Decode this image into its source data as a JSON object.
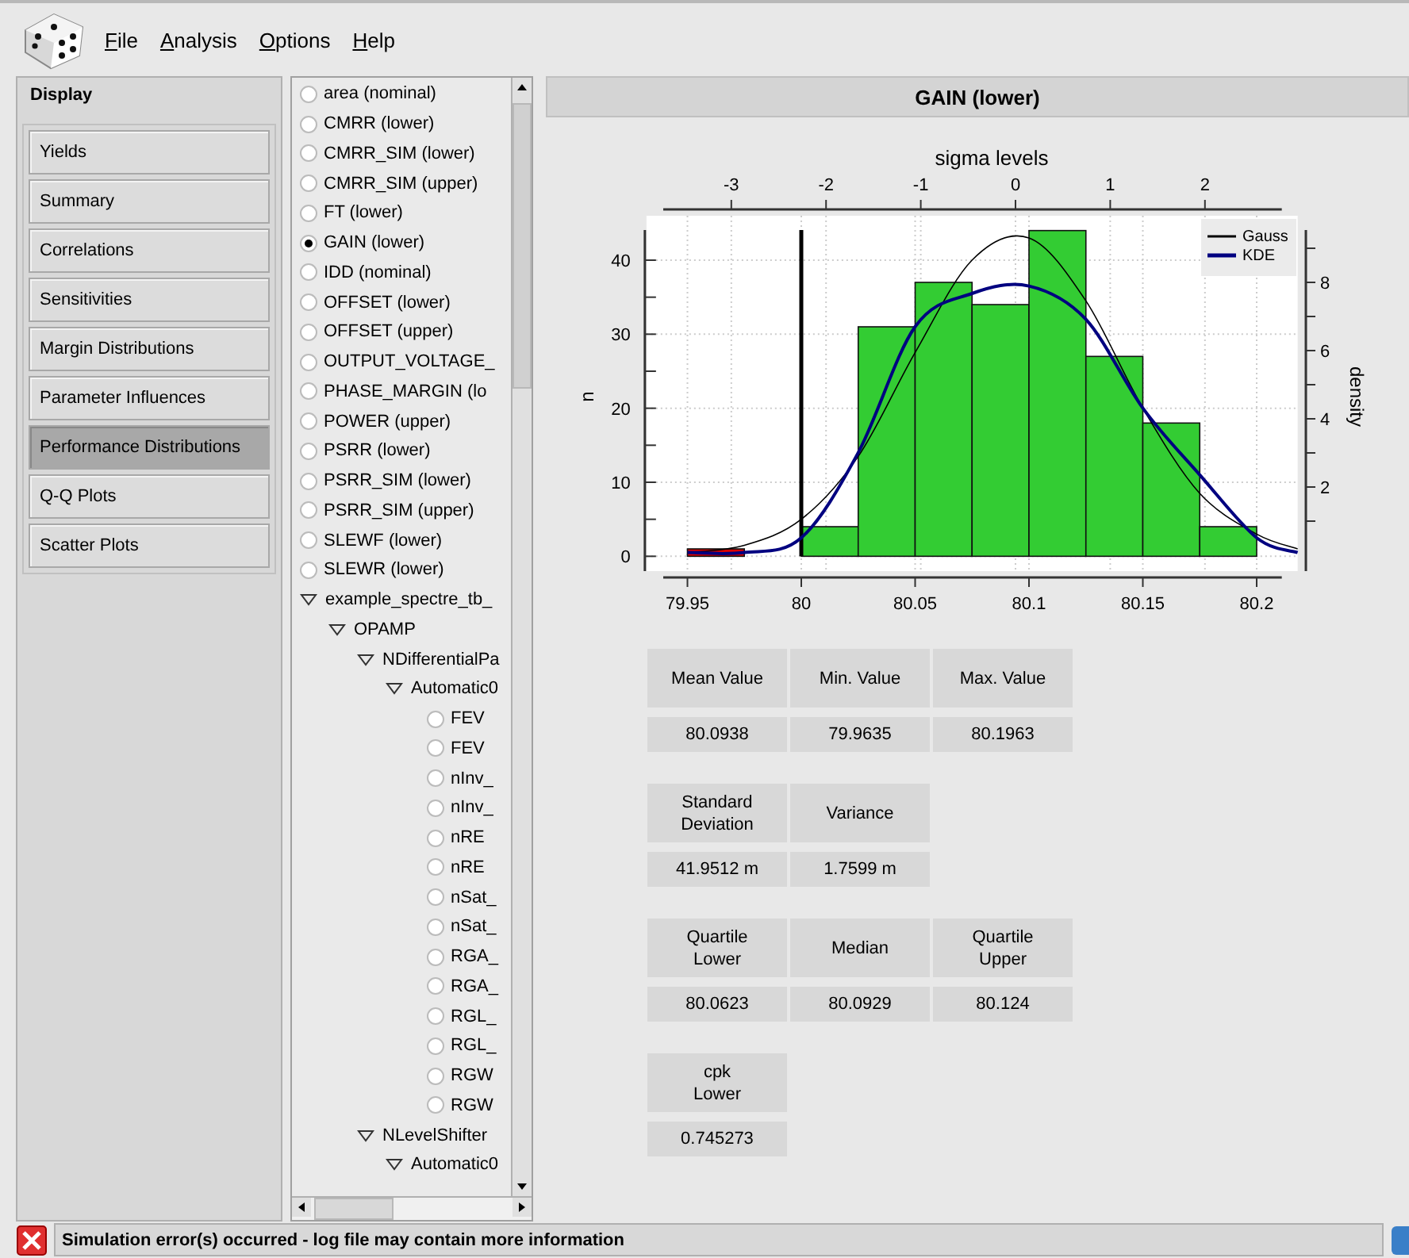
{
  "menu": [
    "File",
    "Analysis",
    "Options",
    "Help"
  ],
  "sidebar": {
    "title": "Display",
    "items": [
      {
        "label": "Yields",
        "selected": false
      },
      {
        "label": "Summary",
        "selected": false
      },
      {
        "label": "Correlations",
        "selected": false
      },
      {
        "label": "Sensitivities",
        "selected": false
      },
      {
        "label": "Margin Distributions",
        "selected": false
      },
      {
        "label": "Parameter Influences",
        "selected": false
      },
      {
        "label": "Performance Distributions",
        "selected": true
      },
      {
        "label": "Q-Q Plots",
        "selected": false
      },
      {
        "label": "Scatter Plots",
        "selected": false
      }
    ]
  },
  "tree": {
    "items": [
      {
        "kind": "radio",
        "label": "area (nominal)",
        "selected": false
      },
      {
        "kind": "radio",
        "label": "CMRR (lower)",
        "selected": false
      },
      {
        "kind": "radio",
        "label": "CMRR_SIM (lower)",
        "selected": false
      },
      {
        "kind": "radio",
        "label": "CMRR_SIM (upper)",
        "selected": false
      },
      {
        "kind": "radio",
        "label": "FT (lower)",
        "selected": false
      },
      {
        "kind": "radio",
        "label": "GAIN (lower)",
        "selected": true
      },
      {
        "kind": "radio",
        "label": "IDD (nominal)",
        "selected": false
      },
      {
        "kind": "radio",
        "label": "OFFSET (lower)",
        "selected": false
      },
      {
        "kind": "radio",
        "label": "OFFSET (upper)",
        "selected": false
      },
      {
        "kind": "radio",
        "label": "OUTPUT_VOLTAGE_",
        "selected": false
      },
      {
        "kind": "radio",
        "label": "PHASE_MARGIN (lo",
        "selected": false
      },
      {
        "kind": "radio",
        "label": "POWER (upper)",
        "selected": false
      },
      {
        "kind": "radio",
        "label": "PSRR (lower)",
        "selected": false
      },
      {
        "kind": "radio",
        "label": "PSRR_SIM (lower)",
        "selected": false
      },
      {
        "kind": "radio",
        "label": "PSRR_SIM (upper)",
        "selected": false
      },
      {
        "kind": "radio",
        "label": "SLEWF (lower)",
        "selected": false
      },
      {
        "kind": "radio",
        "label": "SLEWR (lower)",
        "selected": false
      },
      {
        "kind": "node",
        "label": "example_spectre_tb_",
        "expanded": true,
        "children": [
          {
            "kind": "node",
            "label": "OPAMP",
            "expanded": true,
            "children": [
              {
                "kind": "node",
                "label": "NDifferentialPa",
                "expanded": true,
                "children": [
                  {
                    "kind": "node",
                    "label": "Automatic0",
                    "expanded": true,
                    "children": [
                      {
                        "kind": "radio",
                        "label": "FEV",
                        "selected": false
                      },
                      {
                        "kind": "radio",
                        "label": "FEV",
                        "selected": false
                      },
                      {
                        "kind": "radio",
                        "label": "nInv_",
                        "selected": false
                      },
                      {
                        "kind": "radio",
                        "label": "nInv_",
                        "selected": false
                      },
                      {
                        "kind": "radio",
                        "label": "nRE",
                        "selected": false
                      },
                      {
                        "kind": "radio",
                        "label": "nRE",
                        "selected": false
                      },
                      {
                        "kind": "radio",
                        "label": "nSat_",
                        "selected": false
                      },
                      {
                        "kind": "radio",
                        "label": "nSat_",
                        "selected": false
                      },
                      {
                        "kind": "radio",
                        "label": "RGA_",
                        "selected": false
                      },
                      {
                        "kind": "radio",
                        "label": "RGA_",
                        "selected": false
                      },
                      {
                        "kind": "radio",
                        "label": "RGL_",
                        "selected": false
                      },
                      {
                        "kind": "radio",
                        "label": "RGL_",
                        "selected": false
                      },
                      {
                        "kind": "radio",
                        "label": "RGW",
                        "selected": false
                      },
                      {
                        "kind": "radio",
                        "label": "RGW",
                        "selected": false
                      }
                    ]
                  }
                ]
              },
              {
                "kind": "node",
                "label": "NLevelShifter",
                "expanded": true,
                "children": [
                  {
                    "kind": "node",
                    "label": "Automatic0",
                    "expanded": true
                  }
                ]
              }
            ]
          }
        ]
      }
    ]
  },
  "panel": {
    "title": "GAIN (lower)",
    "chart": {
      "chart_data": {
        "type": "bar",
        "ylabel": "n",
        "x": [
          79.9625,
          79.9875,
          80.0125,
          80.0375,
          80.0625,
          80.0875,
          80.1125,
          80.1375,
          80.1625,
          80.1875
        ],
        "series": [
          {
            "color": "#33cc33",
            "values": [
              null,
              null,
              4,
              31,
              37,
              34,
              44,
              27,
              18,
              4
            ]
          },
          {
            "color": "#dd0000",
            "values": [
              1,
              null,
              null,
              null,
              null,
              null,
              null,
              null,
              null,
              null
            ]
          },
          {
            "name": "Gauss",
            "type": "line",
            "color": "#000000",
            "x": [
              79.95,
              79.975,
              80,
              80.025,
              80.05,
              80.075,
              80.1,
              80.125,
              80.15,
              80.175,
              80.2,
              80.218
            ],
            "values": [
              0.5,
              1.5,
              5,
              13.5,
              27.5,
              40,
              43,
              34.5,
              20,
              8.5,
              3,
              1
            ]
          },
          {
            "name": "KDE",
            "type": "line",
            "color": "#000080",
            "x": [
              79.95,
              79.975,
              80,
              80.025,
              80.05,
              80.075,
              80.1,
              80.125,
              80.15,
              80.175,
              80.2,
              80.218
            ],
            "values": [
              0.5,
              0.5,
              2.5,
              14,
              31,
              35.5,
              36.5,
              32,
              20,
              11,
              2.5,
              0.5
            ]
          }
        ],
        "legend": true,
        "grid": true,
        "xlim": [
          79.932,
          80.218
        ],
        "ylim": [
          -2,
          46
        ],
        "xticks": [
          {
            "value": 79.95,
            "label": "79.95"
          },
          {
            "value": 80,
            "label": "80"
          },
          {
            "value": 80.05,
            "label": "80.05"
          },
          {
            "value": 80.1,
            "label": "80.1"
          },
          {
            "value": 80.15,
            "label": "80.15"
          },
          {
            "value": 80.2,
            "label": "80.2"
          }
        ],
        "yticks": [
          {
            "value": 0,
            "label": "0"
          },
          {
            "value": 10,
            "label": "10"
          },
          {
            "value": 20,
            "label": "20"
          },
          {
            "value": 30,
            "label": "30"
          },
          {
            "value": 40,
            "label": "40"
          }
        ],
        "ref_lines": [
          {
            "axis": "x",
            "value": 80,
            "color": "#000000"
          }
        ]
      },
      "top_axis": {
        "label": "sigma levels",
        "ticks": [
          "-3",
          "-2",
          "-1",
          "0",
          "1",
          "2"
        ]
      },
      "right_axis": {
        "label": "density",
        "ticks": [
          "8",
          "6",
          "4",
          "2"
        ]
      }
    },
    "stats": [
      {
        "headers": [
          "Mean Value",
          "Min. Value",
          "Max. Value"
        ],
        "values": [
          "80.0938",
          "79.9635",
          "80.1963"
        ]
      },
      {
        "headers": [
          "Standard\nDeviation",
          "Variance"
        ],
        "values": [
          "41.9512 m",
          "1.7599 m"
        ]
      },
      {
        "headers": [
          "Quartile\nLower",
          "Median",
          "Quartile\nUpper"
        ],
        "values": [
          "80.0623",
          "80.0929",
          "80.124"
        ]
      },
      {
        "headers": [
          "cpk\nLower"
        ],
        "values": [
          "0.745273"
        ]
      }
    ]
  },
  "status_bar": {
    "message": "Simulation error(s) occurred - log file may contain more information"
  }
}
